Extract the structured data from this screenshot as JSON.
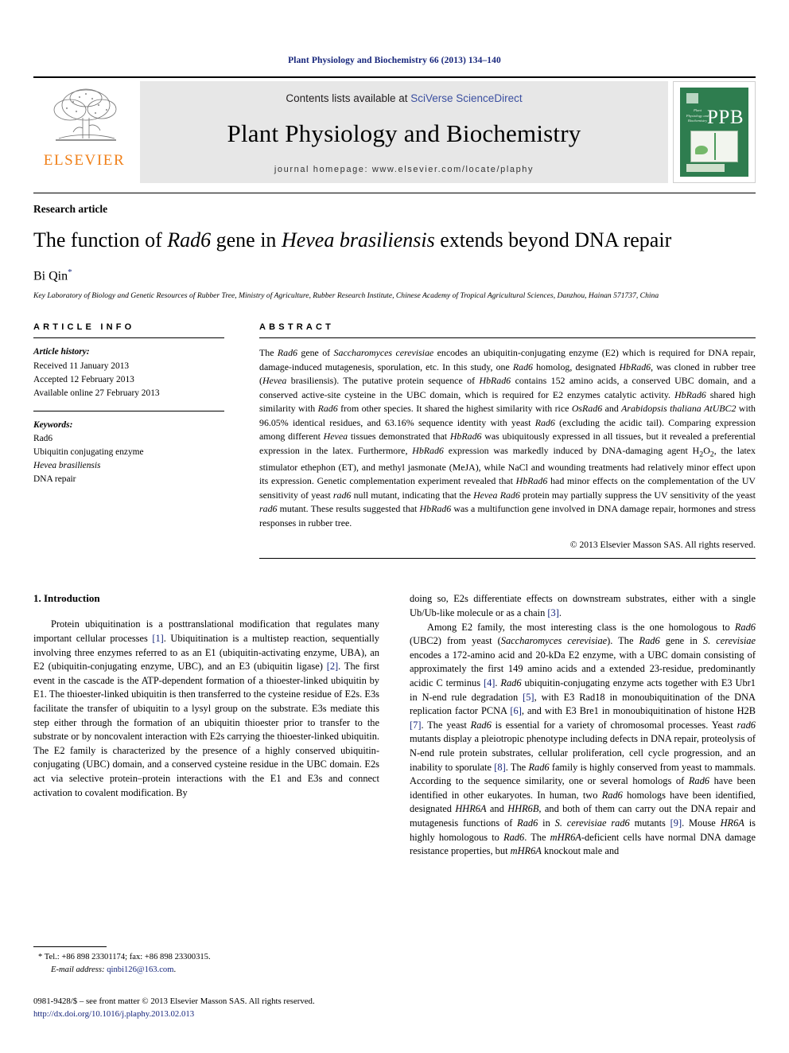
{
  "running_head": "Plant Physiology and Biochemistry 66 (2013) 134–140",
  "masthead": {
    "publisher_name": "ELSEVIER",
    "contents_prefix": "Contents lists available at ",
    "contents_link": "SciVerse ScienceDirect",
    "journal_title": "Plant Physiology and Biochemistry",
    "homepage": "journal homepage: www.elsevier.com/locate/plaphy",
    "cover": {
      "acronym": "PPB",
      "cover_journal_title": "Plant Physiology and Biochemistry"
    }
  },
  "article": {
    "type": "Research article",
    "title_part1": "The function of ",
    "title_italic1": "Rad6",
    "title_part2": " gene in ",
    "title_italic2": "Hevea brasiliensis",
    "title_part3": " extends beyond DNA repair",
    "author": "Bi Qin",
    "author_marker": "*",
    "affiliation": "Key Laboratory of Biology and Genetic Resources of Rubber Tree, Ministry of Agriculture, Rubber Research Institute, Chinese Academy of Tropical Agricultural Sciences, Danzhou, Hainan 571737, China"
  },
  "info": {
    "heading": "ARTICLE INFO",
    "history_label": "Article history:",
    "history": [
      "Received 11 January 2013",
      "Accepted 12 February 2013",
      "Available online 27 February 2013"
    ],
    "keywords_label": "Keywords:",
    "keywords": [
      "Rad6",
      "Ubiquitin conjugating enzyme",
      "Hevea brasiliensis",
      "DNA repair"
    ],
    "keyword_italic_index": 2
  },
  "abstract": {
    "heading": "ABSTRACT",
    "text": "The Rad6 gene of Saccharomyces cerevisiae encodes an ubiquitin-conjugating enzyme (E2) which is required for DNA repair, damage-induced mutagenesis, sporulation, etc. In this study, one Rad6 homolog, designated HbRad6, was cloned in rubber tree (Hevea brasiliensis). The putative protein sequence of HbRad6 contains 152 amino acids, a conserved UBC domain, and a conserved active-site cysteine in the UBC domain, which is required for E2 enzymes catalytic activity. HbRad6 shared high similarity with Rad6 from other species. It shared the highest similarity with rice OsRad6 and Arabidopsis thaliana AtUBC2 with 96.05% identical residues, and 63.16% sequence identity with yeast Rad6 (excluding the acidic tail). Comparing expression among different Hevea tissues demonstrated that HbRad6 was ubiquitously expressed in all tissues, but it revealed a preferential expression in the latex. Furthermore, HbRad6 expression was markedly induced by DNA-damaging agent H2O2, the latex stimulator ethephon (ET), and methyl jasmonate (MeJA), while NaCl and wounding treatments had relatively minor effect upon its expression. Genetic complementation experiment revealed that HbRad6 had minor effects on the complementation of the UV sensitivity of yeast rad6 null mutant, indicating that the Hevea Rad6 protein may partially suppress the UV sensitivity of the yeast rad6 mutant. These results suggested that HbRad6 was a multifunction gene involved in DNA damage repair, hormones and stress responses in rubber tree.",
    "copyright": "© 2013 Elsevier Masson SAS. All rights reserved."
  },
  "body": {
    "section_number_title": "1.  Introduction",
    "left_paragraphs": [
      "Protein ubiquitination is a posttranslational modification that regulates many important cellular processes [1]. Ubiquitination is a multistep reaction, sequentially involving three enzymes referred to as an E1 (ubiquitin-activating enzyme, UBA), an E2 (ubiquitin-conjugating enzyme, UBC), and an E3 (ubiquitin ligase) [2]. The first event in the cascade is the ATP-dependent formation of a thioester-linked ubiquitin by E1. The thioester-linked ubiquitin is then transferred to the cysteine residue of E2s. E3s facilitate the transfer of ubiquitin to a lysyl group on the substrate. E3s mediate this step either through the formation of an ubiquitin thioester prior to transfer to the substrate or by noncovalent interaction with E2s carrying the thioester-linked ubiquitin. The E2 family is characterized by the presence of a highly conserved ubiquitin-conjugating (UBC) domain, and a conserved cysteine residue in the UBC domain. E2s act via selective protein–protein interactions with the E1 and E3s and connect activation to covalent modification. By"
    ],
    "right_paragraph_continuation": "doing so, E2s differentiate effects on downstream substrates, either with a single Ub/Ub-like molecule or as a chain [3].",
    "right_paragraphs": [
      "Among E2 family, the most interesting class is the one homologous to Rad6 (UBC2) from yeast (Saccharomyces cerevisiae). The Rad6 gene in S. cerevisiae encodes a 172-amino acid and 20-kDa E2 enzyme, with a UBC domain consisting of approximately the first 149 amino acids and a extended 23-residue, predominantly acidic C terminus [4]. Rad6 ubiquitin-conjugating enzyme acts together with E3 Ubr1 in N-end rule degradation [5], with E3 Rad18 in monoubiquitination of the DNA replication factor PCNA [6], and with E3 Bre1 in monoubiquitination of histone H2B [7]. The yeast Rad6 is essential for a variety of chromosomal processes. Yeast rad6 mutants display a pleiotropic phenotype including defects in DNA repair, proteolysis of N-end rule protein substrates, cellular proliferation, cell cycle progression, and an inability to sporulate [8]. The Rad6 family is highly conserved from yeast to mammals. According to the sequence similarity, one or several homologs of Rad6 have been identified in other eukaryotes. In human, two Rad6 homologs have been identified, designated HHR6A and HHR6B, and both of them can carry out the DNA repair and mutagenesis functions of Rad6 in S. cerevisiae rad6 mutants [9]. Mouse HR6A is highly homologous to Rad6. The mHR6A-deficient cells have normal DNA damage resistance properties, but mHR6A knockout male and"
    ]
  },
  "footnotes": {
    "contact_marker": "*",
    "contact": "Tel.: +86 898 23301174; fax: +86 898 23300315.",
    "email_label": "E-mail address:",
    "email": "qinbi126@163.com",
    "issn_line": "0981-9428/$ – see front matter © 2013 Elsevier Masson SAS. All rights reserved.",
    "doi": "http://dx.doi.org/10.1016/j.plaphy.2013.02.013"
  },
  "colors": {
    "link_blue": "#16257b",
    "sciencedirect_blue": "#3b4fa0",
    "elsevier_orange": "#f08019",
    "cover_green": "#2e7d4f",
    "band_gray": "#e7e7e7"
  }
}
